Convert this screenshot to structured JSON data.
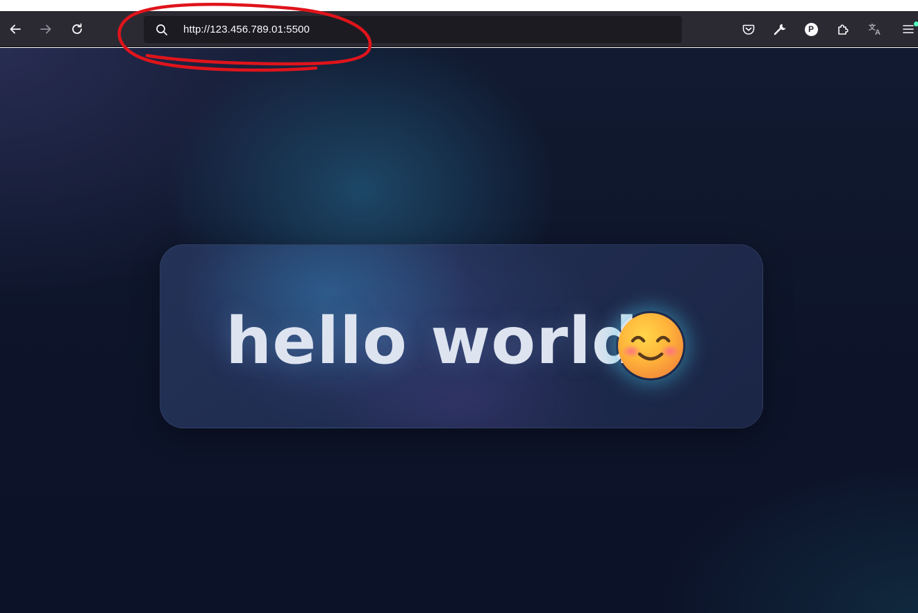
{
  "browser": {
    "url": "http://123.456.789.01:5500",
    "toolbar_icons": {
      "back": "back-arrow-icon",
      "forward": "forward-arrow-icon",
      "reload": "reload-icon",
      "search": "search-icon",
      "pocket": "pocket-icon",
      "tools": "wrench-icon",
      "profile": "profile-icon",
      "extensions": "puzzle-icon",
      "translate": "translate-icon",
      "menu": "hamburger-menu-icon"
    },
    "profile_initial": "P",
    "menu_badge_color": "#54ffbd"
  },
  "page": {
    "heading": "hello world",
    "emoji": "smiling-face-emoji"
  },
  "colors": {
    "toolbar_bg": "#2b2a33",
    "urlbar_bg": "#1c1b22",
    "page_bg": "#0d142a",
    "heading_text": "#dde4f0",
    "annotation_stroke": "#e0141b"
  }
}
